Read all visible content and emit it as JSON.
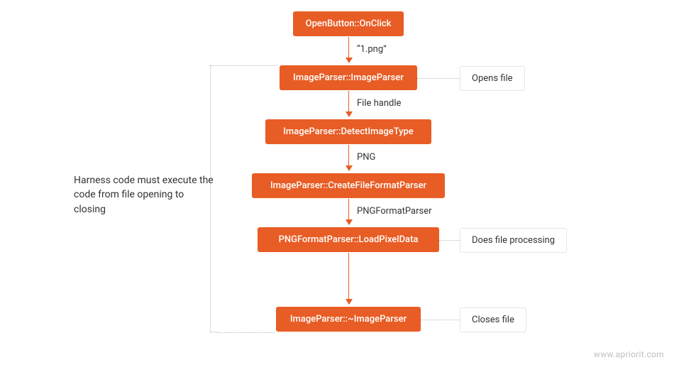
{
  "nodes": {
    "n1": "OpenButton::OnClick",
    "n2": "ImageParser::ImageParser",
    "n3": "ImageParser::DetectImageType",
    "n4": "ImageParser::CreateFileFormatParser",
    "n5": "PNGFormatParser::LoadPixelData",
    "n6": "ImageParser::~ImageParser"
  },
  "edges": {
    "e1": "1.png",
    "e2": "File handle",
    "e3": "PNG",
    "e4": "PNGFormatParser"
  },
  "sideLabels": {
    "s1": "Opens file",
    "s2": "Does file processing",
    "s3": "Closes file"
  },
  "leftNote": "Harness code must execute the code from file opening to closing",
  "watermark": "www.apriorit.com"
}
